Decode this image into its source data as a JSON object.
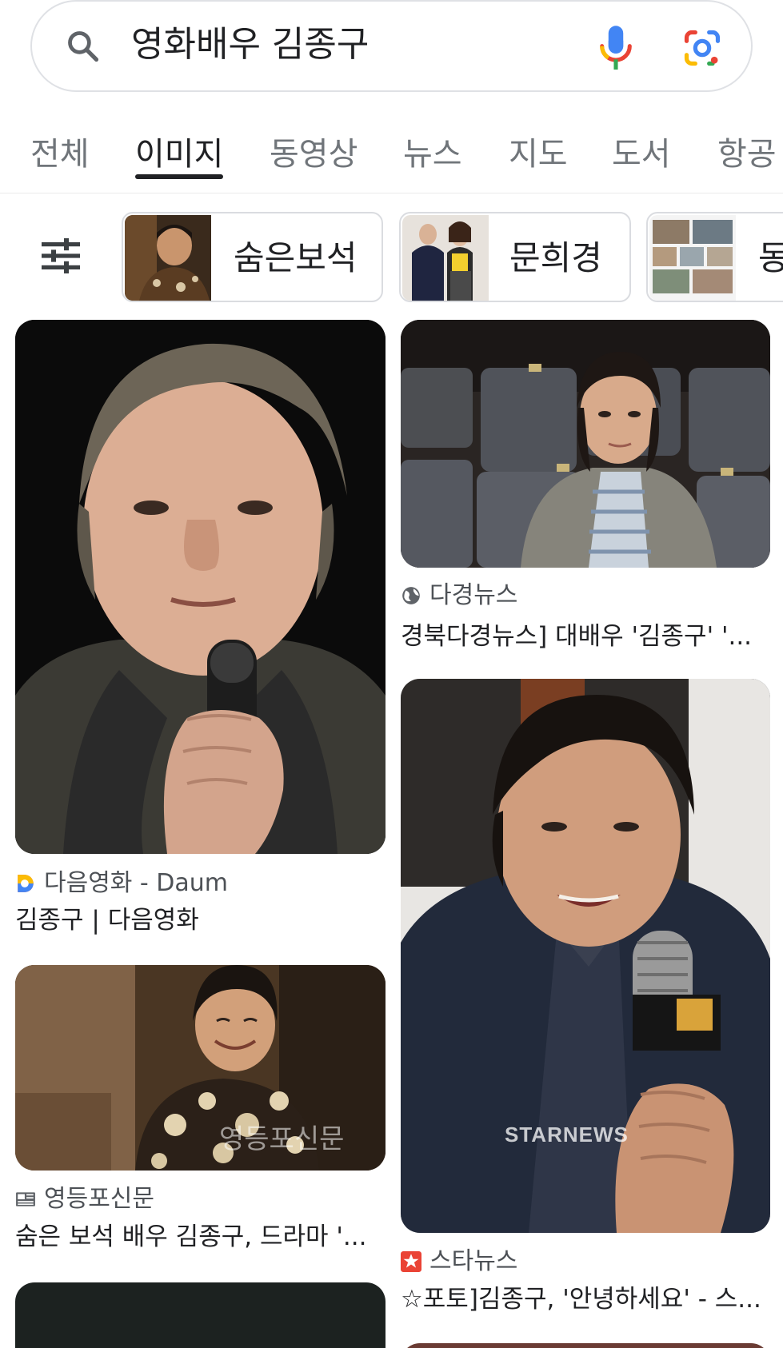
{
  "search": {
    "query": "영화배우 김종구",
    "icons": [
      "search-icon",
      "mic-icon",
      "google-lens-icon"
    ]
  },
  "tabs": [
    {
      "label": "전체",
      "active": false
    },
    {
      "label": "이미지",
      "active": true
    },
    {
      "label": "동영상",
      "active": false
    },
    {
      "label": "뉴스",
      "active": false
    },
    {
      "label": "지도",
      "active": false
    },
    {
      "label": "도서",
      "active": false
    },
    {
      "label": "항공",
      "active": false
    }
  ],
  "filters": {
    "icon": "tune-icon",
    "chips": [
      {
        "label": "숨은보석"
      },
      {
        "label": "문희경"
      },
      {
        "label": "동"
      }
    ]
  },
  "results": [
    {
      "source": "다음영화 - Daum",
      "source_icon": "daum-logo-icon",
      "title": "김종구 | 다음영화"
    },
    {
      "source": "다경뉴스",
      "source_icon": "globe-icon",
      "title": "경북다경뉴스] 대배우 '김종구' '..."
    },
    {
      "source": "영등포신문",
      "source_icon": "newspaper-icon",
      "title": "숨은 보석 배우 김종구, 드라마 '...",
      "watermark": "영등포신문"
    },
    {
      "source": "스타뉴스",
      "source_icon": "starnews-logo-icon",
      "title": "☆포토]김종구, '안녕하세요' - 스...",
      "watermark": "STARNEWS"
    }
  ],
  "colors": {
    "google_blue": "#4285F4",
    "google_red": "#EA4335",
    "google_yellow": "#FBBC05",
    "google_green": "#34A853",
    "text_primary": "#202124",
    "text_secondary": "#70757a"
  }
}
